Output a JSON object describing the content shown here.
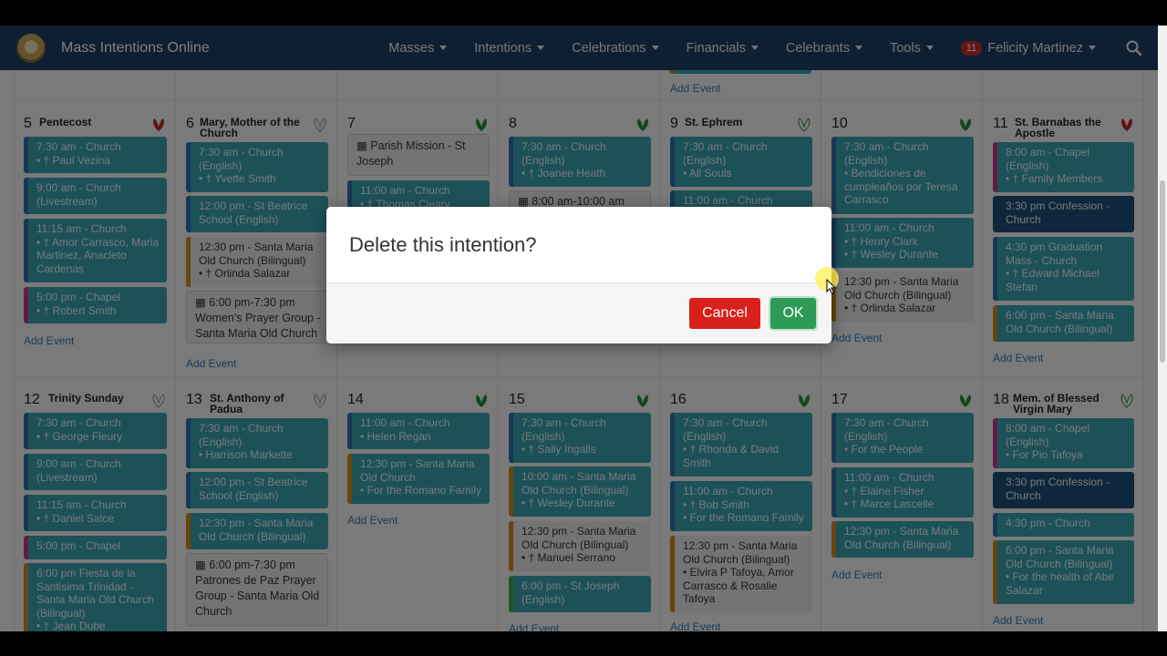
{
  "app": {
    "title": "Mass Intentions Online"
  },
  "nav": {
    "items": [
      "Masses",
      "Intentions",
      "Celebrations",
      "Financials",
      "Celebrants",
      "Tools"
    ],
    "notification_count": "11",
    "user_name": "Felicity Martinez"
  },
  "colors": {
    "navbar": "#1f3f66",
    "event_teal": "#3aa3b0",
    "cancel_red": "#d9201a",
    "ok_green": "#2e9a57"
  },
  "calendar": {
    "top_links": {
      "add_event": "Add Event"
    },
    "week1": {
      "d5": {
        "num": "5",
        "title": "Pentecost"
      },
      "d6": {
        "num": "6",
        "title": "Mary, Mother of the Church"
      },
      "d7": {
        "num": "7"
      },
      "d8": {
        "num": "8"
      },
      "d9": {
        "num": "9",
        "title": "St. Ephrem"
      },
      "d10": {
        "num": "10"
      },
      "d11": {
        "num": "11",
        "title": "St. Barnabas the Apostle"
      }
    },
    "week2": {
      "d12": {
        "num": "12",
        "title": "Trinity Sunday"
      },
      "d13": {
        "num": "13",
        "title": "St. Anthony of Padua"
      },
      "d14": {
        "num": "14"
      },
      "d15": {
        "num": "15"
      },
      "d16": {
        "num": "16"
      },
      "d17": {
        "num": "17"
      },
      "d18": {
        "num": "18",
        "title": "Mem. of Blessed Virgin Mary"
      }
    },
    "events": {
      "e5a": [
        "7:30 am - Church",
        "• † Paul Vezina"
      ],
      "e5b": [
        "9:00 am - Church",
        "(Livestream)"
      ],
      "e5c": [
        "11:15 am - Church",
        "• † Amor Carrasco, Maria",
        "Martinez, Anacleto",
        "Cardenas"
      ],
      "e5d": [
        "5:00 pm - Chapel",
        "• † Robert Smith"
      ],
      "e6a": [
        "7:30 am - Church",
        "(English)",
        "• † Yvette Smith"
      ],
      "e6b": [
        "12:00 pm - St Beatrice",
        "School (English)"
      ],
      "e6c": [
        "12:30 pm - Santa Maria",
        "Old Church (Bilingual)",
        "• † Orlinda Salazar"
      ],
      "e6d": [
        "▦ 6:00 pm-7:30 pm",
        "Women's Prayer Group -",
        "Santa Maria Old Church"
      ],
      "e7a": [
        "▦ Parish Mission - St",
        "Joseph"
      ],
      "e7b": [
        "11:00 am - Church",
        "• † Thomas Cleary"
      ],
      "e8a": [
        "7:30 am - Church",
        "(English)",
        "• † Joanee Heath"
      ],
      "e8b": [
        "▦ 8:00 am-10:00 am"
      ],
      "e9a": [
        "7:30 am - Church",
        "(English)",
        "• All Souls"
      ],
      "e9b": [
        "11:00 am - Church"
      ],
      "e10a": [
        "7:30 am - Church",
        "(English)",
        "• Bendiciones de",
        "cumpleaños por Teresa",
        "Carrasco"
      ],
      "e10b": [
        "11:00 am - Church",
        "• † Henry Clark",
        "• † Wesley Durante"
      ],
      "e10c": [
        "12:30 pm - Santa Maria",
        "Old Church (Bilingual)",
        "• † Orlinda Salazar"
      ],
      "e11a": [
        "8:00 am - Chapel",
        "(English)",
        "• † Family Members"
      ],
      "e11b": [
        "3:30 pm Confession -",
        "Church"
      ],
      "e11c": [
        "4:30 pm Graduation",
        "Mass - Church",
        "• † Edward Michael",
        "Stefan"
      ],
      "e11d": [
        "6:00 pm - Santa Maria",
        "Old Church (Bilingual)"
      ],
      "e12a": [
        "7:30 am - Church",
        "• † George Fleury"
      ],
      "e12b": [
        "9:00 am - Church",
        "(Livestream)"
      ],
      "e12c": [
        "11:15 am - Church",
        "• † Daniel Salce"
      ],
      "e12d": [
        "5:00 pm - Chapel"
      ],
      "e12e": [
        "6:00 pm Fiesta de la",
        "Santisima Trinidad -",
        "Santa Maria Old Church",
        "(Bilingual)",
        "• † Jean Dube"
      ],
      "e13a": [
        "7:30 am - Church",
        "(English)",
        "• Harrison Markette"
      ],
      "e13b": [
        "12:00 pm - St Beatrice",
        "School (English)"
      ],
      "e13c": [
        "12:30 pm - Santa Maria",
        "Old Church (Bilingual)"
      ],
      "e13d": [
        "▦ 6:00 pm-7:30 pm",
        "Patrones de Paz Prayer",
        "Group - Santa Maria Old",
        "Church"
      ],
      "e14a": [
        "11:00 am - Church",
        "• Helen Regan"
      ],
      "e14b": [
        "12:30 pm - Santa Maria",
        "Old Church",
        "• For the Romano Family"
      ],
      "e15a": [
        "7:30 am - Church",
        "(English)",
        "• † Sally Ingalls"
      ],
      "e15b": [
        "10:00 am - Santa Maria",
        "Old Church (Bilingual)",
        "• † Wesley Durante"
      ],
      "e15c": [
        "12:30 pm - Santa Maria",
        "Old Church (Bilingual)",
        "• † Manuel Serrano"
      ],
      "e15d": [
        "6:00 pm - St Joseph",
        "(English)"
      ],
      "e16a": [
        "7:30 am - Church",
        "(English)",
        "• † Rhonda & David",
        "Smith"
      ],
      "e16b": [
        "11:00 am - Church",
        "• † Bob Smith",
        "• For the Romano Family"
      ],
      "e16c": [
        "12:30 pm - Santa Maria",
        "Old Church (Bilingual)",
        "• Elvira P Tafoya, Amor",
        "Carrasco & Rosalie",
        "Tafoya"
      ],
      "e17a": [
        "7:30 am - Church",
        "(English)",
        "• For the People"
      ],
      "e17b": [
        "11:00 am - Church",
        "• † Elaine Fisher",
        "• † Marce Lascelle"
      ],
      "e17c": [
        "12:30 pm - Santa Maria",
        "Old Church (Bilingual)"
      ],
      "e18a": [
        "8:00 am - Chapel",
        "(English)",
        "• For Pio Tafoya"
      ],
      "e18b": [
        "3:30 pm Confession -",
        "Church"
      ],
      "e18c": [
        "4:30 pm - Church"
      ],
      "e18d": [
        "6:00 pm - Santa Maria",
        "Old Church (Bilingual)",
        "• For the health of Abe",
        "Salazar"
      ]
    },
    "add_event_label": "Add Event"
  },
  "modal": {
    "title": "Delete this intention?",
    "cancel_label": "Cancel",
    "ok_label": "OK"
  }
}
